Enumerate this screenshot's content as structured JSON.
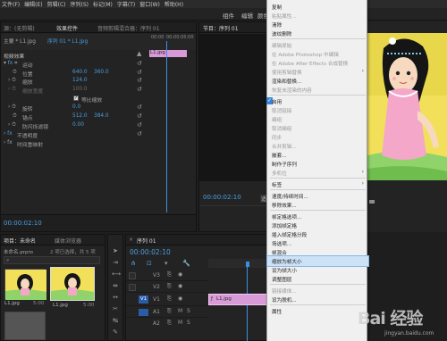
{
  "menubar": {
    "items": [
      "文件(F)",
      "编辑(E)",
      "剪辑(C)",
      "序列(S)",
      "标记(M)",
      "字幕(T)",
      "窗口(W)",
      "帮助(H)"
    ]
  },
  "workspace": {
    "tabs": [
      "组件",
      "编辑",
      "颜色"
    ]
  },
  "effect_panel": {
    "tabs": [
      "源：(无剪辑)",
      "效果控件",
      "音频剪辑混合器：序列 01"
    ],
    "master": "主要 * L1.jpg",
    "sequence_clip": "序列 01 * L1.jpg",
    "ruler_start": "00:00",
    "ruler_mid": "00:00:05:00",
    "clip_label": "L1.jpg",
    "video_effects": "视频效果",
    "motion": "运动",
    "position_label": "位置",
    "position_x": "640.0",
    "position_y": "360.0",
    "scale_label": "缩放",
    "scale_value": "124.0",
    "scale_width_label": "缩放宽度",
    "scale_width_value": "100.0",
    "uniform_scale": "等比缩放",
    "rotation_label": "旋转",
    "rotation_value": "0.0",
    "anchor_label": "锚点",
    "anchor_x": "512.0",
    "anchor_y": "384.0",
    "flicker_label": "防闪烁滤镜",
    "flicker_value": "0.00",
    "opacity": "不透明度",
    "time_remap": "时间重映射",
    "timecode": "00:00:02:10"
  },
  "program": {
    "title": "节目：序列 01",
    "timecode": "00:00:02:10",
    "fit_btn": "适"
  },
  "project": {
    "tabs": [
      "项目：未命名",
      "媒体浏览器"
    ],
    "folder": "未命名.prpro",
    "selected": "2 项已选择，共 5 项",
    "items": [
      {
        "name": "L1.jpg",
        "duration": "5:00"
      },
      {
        "name": "L1.jpg",
        "duration": "5:00"
      }
    ]
  },
  "timeline": {
    "title": "序列 01",
    "timecode": "00:00:02:10",
    "tracks": [
      "V3",
      "V2",
      "V1",
      "A1",
      "A2"
    ],
    "source_track": "V1",
    "clip_name": "L1.jpg"
  },
  "context_menu": {
    "items": [
      {
        "label": "复制",
        "disabled": false
      },
      {
        "label": "粘贴属性...",
        "disabled": true
      },
      {
        "label": "清除",
        "disabled": false
      },
      {
        "label": "波纹删除",
        "disabled": false
      },
      {
        "sep": true
      },
      {
        "label": "编辑原始",
        "disabled": true
      },
      {
        "label": "在 Adobe Photoshop 中编辑",
        "disabled": true
      },
      {
        "label": "在 Adobe After Effects 合成替换",
        "disabled": true
      },
      {
        "label": "使用剪辑替换",
        "disabled": true,
        "submenu": true
      },
      {
        "label": "渲染和替换...",
        "disabled": false
      },
      {
        "label": "恢复未渲染的内容",
        "disabled": true
      },
      {
        "sep": true
      },
      {
        "label": "启用",
        "disabled": false,
        "checked": true
      },
      {
        "label": "取消链接",
        "disabled": true
      },
      {
        "label": "编组",
        "disabled": true
      },
      {
        "label": "取消编组",
        "disabled": true
      },
      {
        "label": "同步",
        "disabled": true
      },
      {
        "label": "合并剪辑...",
        "disabled": true
      },
      {
        "label": "嵌套...",
        "disabled": false
      },
      {
        "label": "制作子序列",
        "disabled": false
      },
      {
        "label": "多机位",
        "disabled": true,
        "submenu": true
      },
      {
        "sep": true
      },
      {
        "label": "标签",
        "disabled": false,
        "submenu": true
      },
      {
        "sep": true
      },
      {
        "label": "速度/持续时间...",
        "disabled": false
      },
      {
        "label": "移除效果...",
        "disabled": false
      },
      {
        "sep": true
      },
      {
        "label": "帧定格选项...",
        "disabled": false
      },
      {
        "label": "添加帧定格",
        "disabled": false
      },
      {
        "label": "插入帧定格分段",
        "disabled": false
      },
      {
        "label": "场选项...",
        "disabled": false
      },
      {
        "label": "帧混合",
        "disabled": false
      },
      {
        "label": "缩放为帧大小",
        "disabled": false,
        "highlight": true
      },
      {
        "label": "设为帧大小",
        "disabled": false
      },
      {
        "label": "调整图层",
        "disabled": false
      },
      {
        "sep": true
      },
      {
        "label": "链接媒体...",
        "disabled": true
      },
      {
        "label": "设为脱机...",
        "disabled": false
      },
      {
        "sep": true
      },
      {
        "label": "属性",
        "disabled": false
      }
    ]
  },
  "watermark": {
    "text": "Bai 经验",
    "url": "jingyan.baidu.com"
  },
  "colors": {
    "accent_blue": "#4a9fe0",
    "clip_pink": "#d99ad8",
    "menu_bg": "#f0f0f0",
    "menu_highlight": "#cce2f7",
    "playhead": "#3b8fe6",
    "video_track": "#2a5da8"
  }
}
